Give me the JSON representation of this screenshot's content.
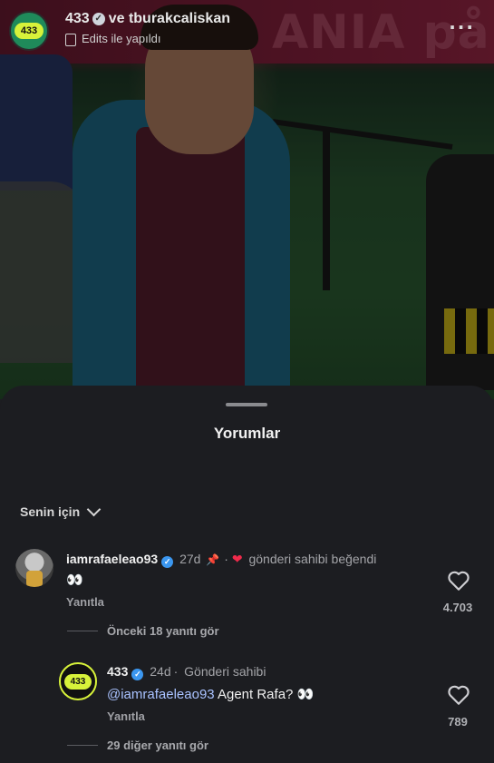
{
  "video": {
    "banner_text": "ANIA på U",
    "account": "433",
    "collaborator": "ve tburakcaliskan",
    "subtitle": "Edits ile yapıldı",
    "logo_text": "433"
  },
  "sheet": {
    "title": "Yorumlar",
    "sort_label": "Senin için"
  },
  "comments": [
    {
      "username": "iamrafaeleao93",
      "age": "27d",
      "owner_liked": "gönderi sahibi beğendi",
      "text": "👀",
      "reply_label": "Yanıtla",
      "like_count": "4.703",
      "view_replies": "Önceki 18 yanıtı gör"
    },
    {
      "username": "433",
      "age": "24d",
      "role": "Gönderi sahibi",
      "mention": "@iamrafaeleao93",
      "text": "Agent Rafa? 👀",
      "reply_label": "Yanıtla",
      "like_count": "789",
      "view_replies": "29 diğer yanıtı gör",
      "logo_text": "433"
    }
  ],
  "colors": {
    "sheet_bg": "#1c1d21",
    "verified_blue": "#3b97f0",
    "heart_red": "#f02a4b",
    "brand_lime": "#d7f23a",
    "mention": "#a9c2ff"
  }
}
